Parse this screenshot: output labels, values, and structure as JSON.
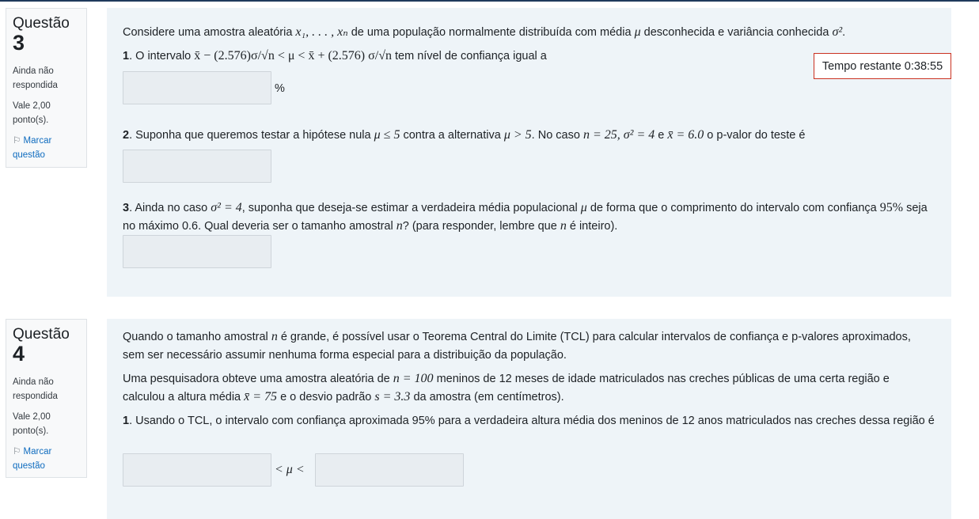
{
  "timer": {
    "label": "Tempo restante 0:38:55"
  },
  "questions": [
    {
      "label": "Questão",
      "number": "3",
      "status": "Ainda não respondida",
      "grade": "Vale 2,00 ponto(s).",
      "flag": "Marcar questão",
      "intro": {
        "pre": "Considere uma amostra aleatória ",
        "math1": "x₁, . . . , xₙ",
        "mid": " de uma população normalmente distribuída com média ",
        "math2": "μ",
        "mid2": " desconhecida e variância conhecida ",
        "math3": "σ²",
        "post": "."
      },
      "items": [
        {
          "num": "1",
          "pre": ". O intervalo ",
          "math": "x̄ − (2.576)σ/√n < μ < x̄ + (2.576) σ/√n",
          "post": " tem nível de confiança igual a",
          "suffix": "%"
        },
        {
          "num": "2",
          "pre": ". Suponha que queremos testar a hipótese nula ",
          "math1": "μ ≤ 5",
          "mid1": " contra a alternativa ",
          "math2": "μ > 5",
          "mid2": ". No caso ",
          "math3": "n = 25, σ² = 4",
          "mid3": " e ",
          "math4": "x̄ = 6.0",
          "post": " o p-valor do teste é"
        },
        {
          "num": "3",
          "pre": ". Ainda no caso ",
          "math1": "σ² = 4",
          "mid1": ", suponha que deseja-se estimar a verdadeira média populacional ",
          "math2": "μ",
          "mid2": " de forma que o comprimento do intervalo com confiança ",
          "math3": "95%",
          "post": " seja",
          "line2_pre": "no máximo 0.6. Qual deveria ser o tamanho amostral ",
          "line2_math": "n",
          "line2_mid": "? (para responder, lembre que ",
          "line2_math2": "n",
          "line2_post": " é inteiro)."
        }
      ]
    },
    {
      "label": "Questão",
      "number": "4",
      "status": "Ainda não respondida",
      "grade": "Vale 2,00 ponto(s).",
      "flag": "Marcar questão",
      "p1_line1_pre": "Quando o tamanho amostral ",
      "p1_line1_math": "n",
      "p1_line1_post": " é grande, é possível usar o Teorema Central do Limite (TCL) para calcular intervalos de confiança e p-valores aproximados,",
      "p1_line2": "sem ser necessário assumir nenhuma forma especial para a distribuição da população.",
      "p2_line1_pre": "Uma pesquisadora obteve uma amostra aleatória de ",
      "p2_line1_math": "n = 100",
      "p2_line1_post": " meninos de 12 meses de idade matriculados nas creches públicas de uma certa região e",
      "p2_line2_pre": "calculou a altura média ",
      "p2_line2_math1": "x̄ = 75",
      "p2_line2_mid": " e o desvio padrão ",
      "p2_line2_math2": "s = 3.3",
      "p2_line2_post": " da amostra (em centímetros).",
      "item1_num": "1",
      "item1_text": ". Usando o TCL, o intervalo com confiança aproximada 95% para a verdadeira altura média dos meninos de 12 anos matriculados nas creches dessa região é",
      "between": "< μ <"
    }
  ]
}
